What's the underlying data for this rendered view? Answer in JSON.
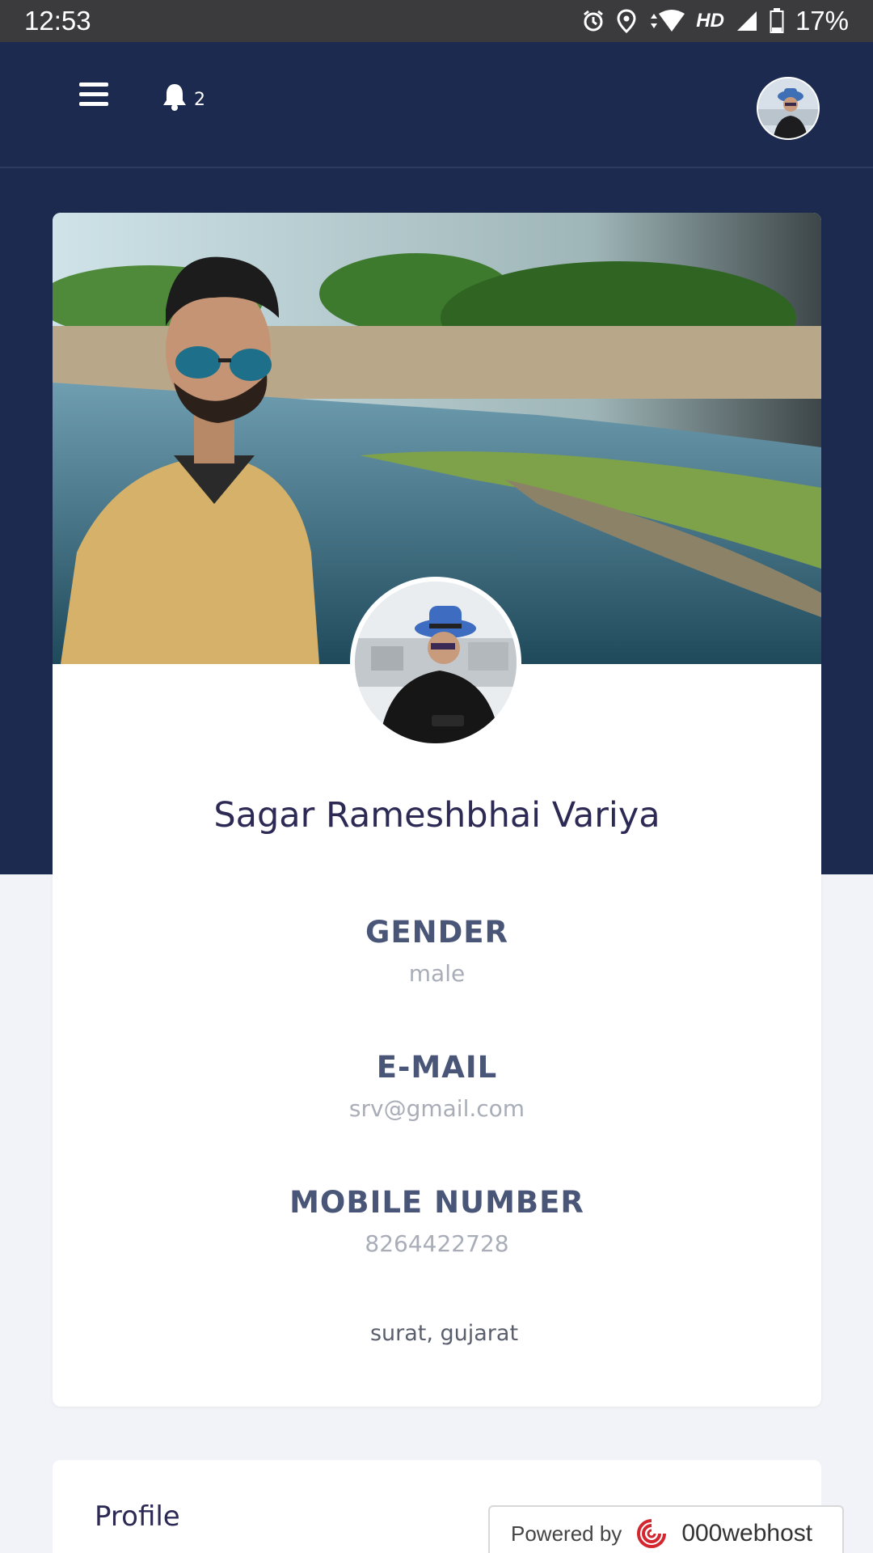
{
  "status_bar": {
    "time": "12:53",
    "battery": "17%",
    "network": "HD",
    "icons": [
      "alarm-icon",
      "location-icon",
      "wifi-icon",
      "signal-icon",
      "battery-icon"
    ]
  },
  "navbar": {
    "menu_icon": "hamburger-icon",
    "notification_count": "2",
    "bg_color": "#1b2a4e"
  },
  "profile": {
    "name": "Sagar Rameshbhai Variya",
    "fields": [
      {
        "label": "GENDER",
        "value": "male"
      },
      {
        "label": "E-MAIL",
        "value": "srv@gmail.com"
      },
      {
        "label": "MOBILE NUMBER",
        "value": "8264422728"
      }
    ],
    "location": "surat, gujarat"
  },
  "section2": {
    "title": "Profile"
  },
  "badge": {
    "prefix": "Powered by",
    "brand": "000webhost"
  }
}
